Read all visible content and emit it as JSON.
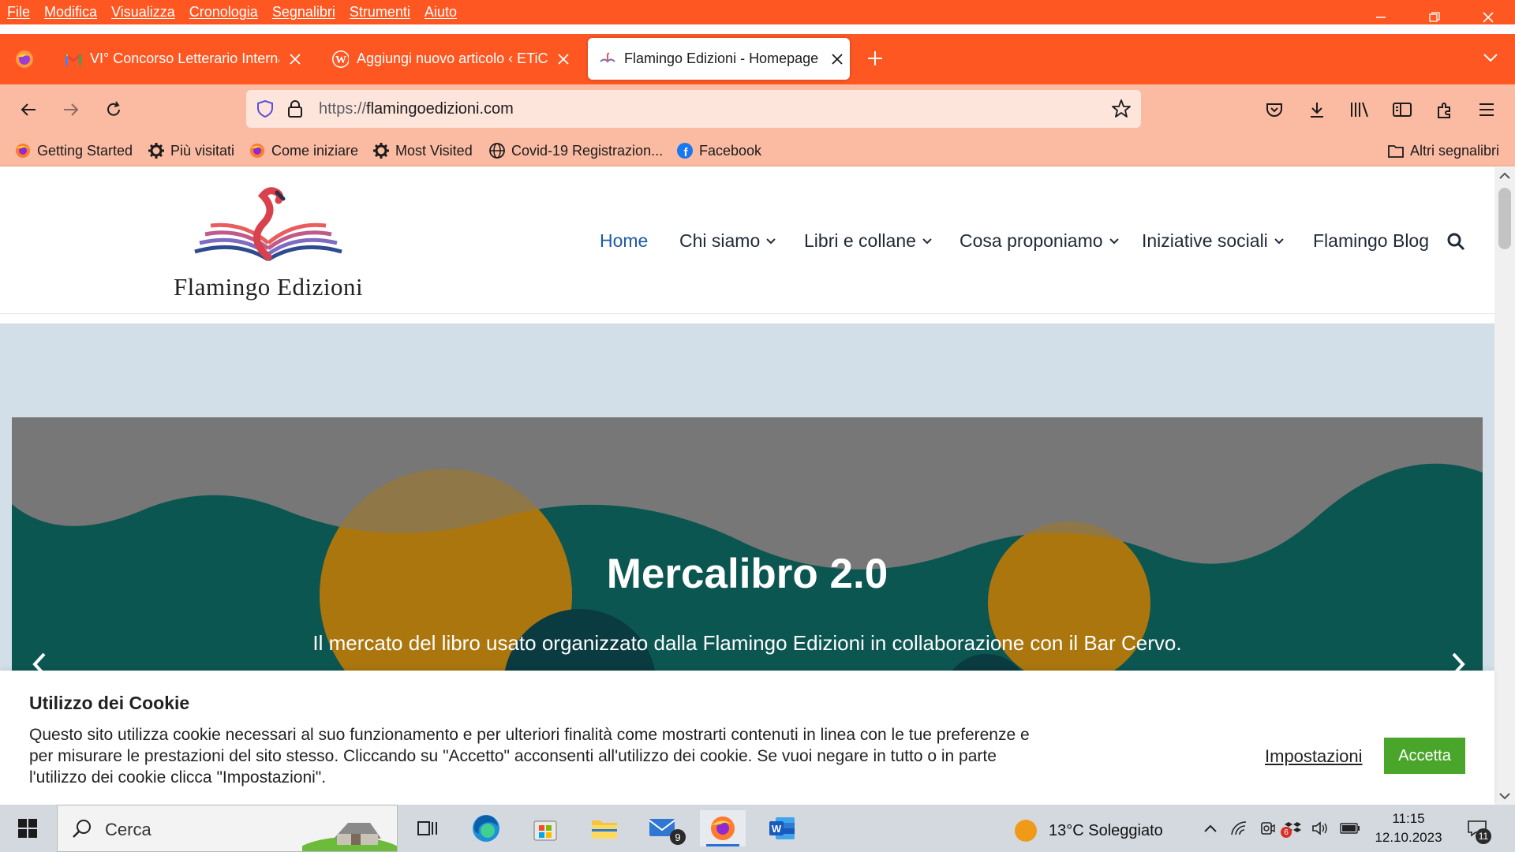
{
  "browser": {
    "menu": [
      "File",
      "Modifica",
      "Visualizza",
      "Cronologia",
      "Segnalibri",
      "Strumenti",
      "Aiuto"
    ],
    "tabs": [
      {
        "label": "VI° Concorso Letterario Interna",
        "icon": "gmail-icon"
      },
      {
        "label": "Aggiungi nuovo articolo ‹ ETiCi",
        "icon": "wordpress-icon"
      },
      {
        "label": "Flamingo Edizioni - Homepage",
        "icon": "flamingo-favicon-icon",
        "active": true
      }
    ],
    "url": {
      "protocol": "https://",
      "domain": "flamingoedizioni.com"
    },
    "bookmarks": [
      {
        "label": "Getting Started",
        "icon": "firefox-icon"
      },
      {
        "label": "Più visitati",
        "icon": "gear-icon"
      },
      {
        "label": "Come iniziare",
        "icon": "firefox-icon"
      },
      {
        "label": "Most Visited",
        "icon": "gear-icon"
      },
      {
        "label": "Covid-19 Registrazion...",
        "icon": "globe-icon"
      },
      {
        "label": "Facebook",
        "icon": "facebook-icon"
      }
    ],
    "other_bookmarks": "Altri segnalibri",
    "accent": "#fe5722"
  },
  "site": {
    "logo_text": "Flamingo Edizioni",
    "nav": [
      {
        "label": "Home",
        "active": true
      },
      {
        "label": "Chi siamo",
        "dropdown": true
      },
      {
        "label": "Libri e collane",
        "dropdown": true
      },
      {
        "label": "Cosa proponiamo",
        "dropdown": true
      },
      {
        "label": "Iniziative sociali",
        "dropdown": true
      },
      {
        "label": "Flamingo Blog"
      }
    ],
    "slider": {
      "title": "Mercalibro 2.0",
      "subtitle": "Il mercato del libro usato organizzato dalla Flamingo Edizioni in collaborazione con il Bar Cervo."
    },
    "cookie": {
      "title": "Utilizzo dei Cookie",
      "text": "Questo sito utilizza cookie necessari al suo funzionamento e per ulteriori finalità come mostrarti contenuti in linea con le tue preferenze e per misurare le prestazioni del sito stesso. Cliccando su \"Accetto\" acconsenti all'utilizzo dei cookie. Se vuoi negare in tutto o in parte l'utilizzo dei cookie clicca \"Impostazioni\".",
      "settings_label": "Impostazioni",
      "accept_label": "Accetta",
      "accept_color": "#4aa62a"
    }
  },
  "taskbar": {
    "search_placeholder": "Cerca",
    "mail_badge": "9",
    "weather": "13°C  Soleggiato",
    "time": "11:15",
    "date": "12.10.2023",
    "notification_count": "11",
    "tray_badge": "6"
  }
}
